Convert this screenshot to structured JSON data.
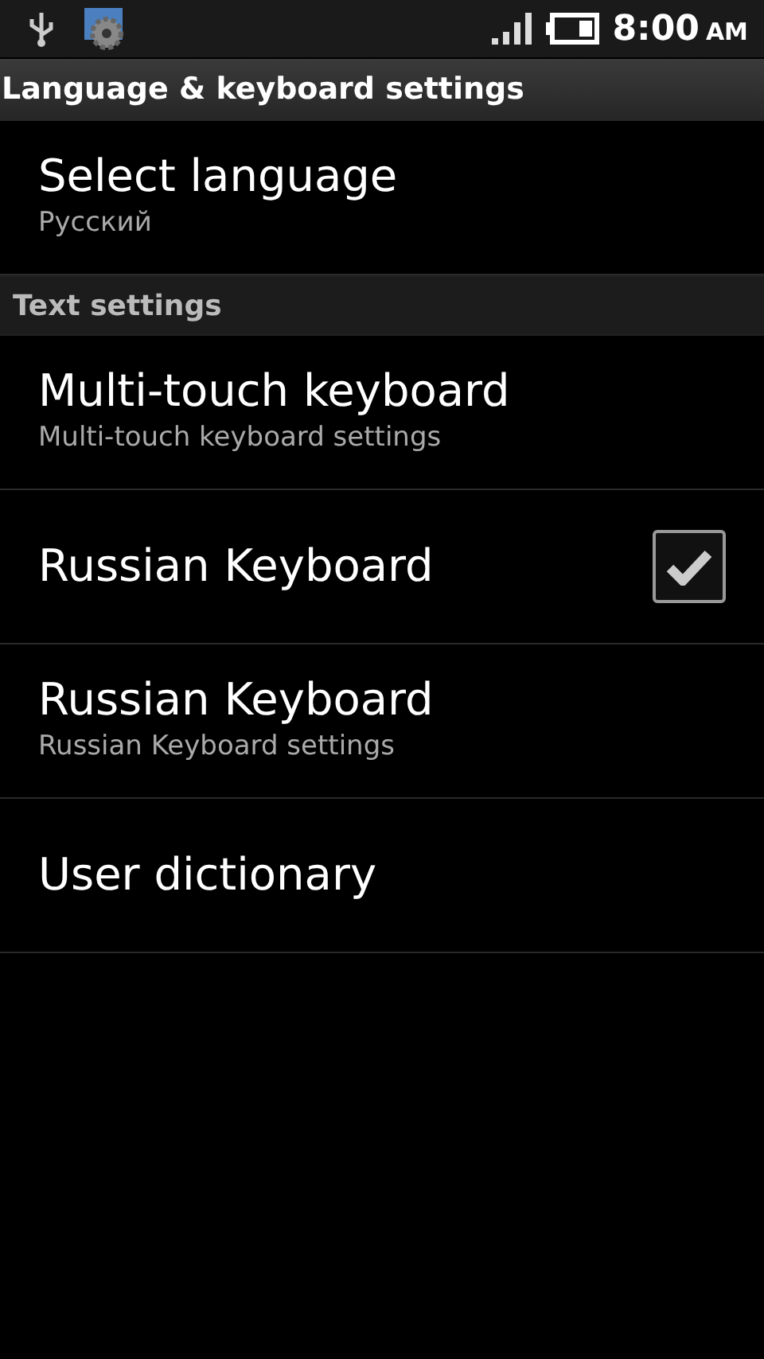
{
  "status_bar": {
    "time": "8:00",
    "meridiem": "AM"
  },
  "window": {
    "title": "Language & keyboard settings"
  },
  "sections": [
    {
      "items": [
        {
          "kind": "setting",
          "title": "Select language",
          "summary": "Русский"
        }
      ]
    },
    {
      "header": "Text settings",
      "items": [
        {
          "kind": "setting",
          "title": "Multi-touch keyboard",
          "summary": "Multi-touch keyboard settings"
        },
        {
          "kind": "checkbox",
          "title": "Russian Keyboard",
          "checked": true
        },
        {
          "kind": "setting",
          "title": "Russian Keyboard",
          "summary": "Russian Keyboard settings"
        },
        {
          "kind": "setting",
          "title": "User dictionary"
        }
      ]
    }
  ]
}
